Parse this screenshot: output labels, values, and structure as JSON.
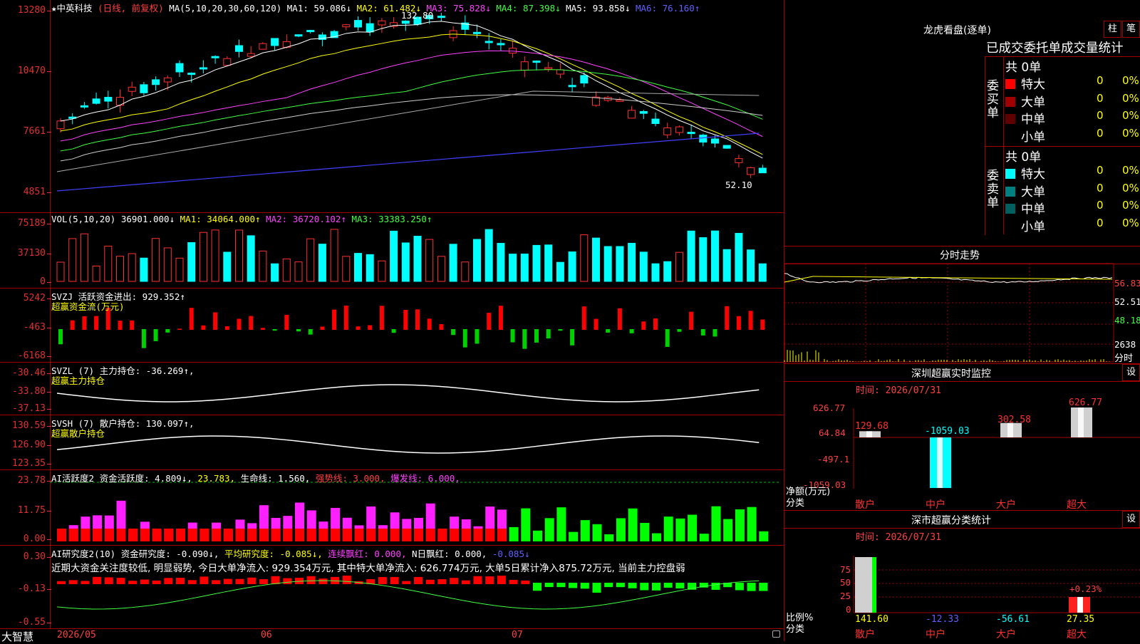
{
  "stock_header": {
    "title": "★中英科技",
    "mode": "(日线, 前复权)",
    "ma_label": "MA(5,10,20,30,60,120)",
    "ma1": "MA1: 59.086↓",
    "ma2": "MA2: 61.482↓",
    "ma3": "MA3: 75.828↓",
    "ma4": "MA4: 87.398↓",
    "ma5": "MA5: 93.858↓",
    "ma6": "MA6: 76.160↑",
    "high_mark": "132.80",
    "low_mark": "52.10"
  },
  "price_axis": [
    "13280",
    "10470",
    "7661",
    "4851"
  ],
  "vol": {
    "label": "VOL(5,10,20)",
    "val": "36901.000↓",
    "ma1": "MA1: 34064.000↑",
    "ma2": "MA2: 36720.102↑",
    "ma3": "MA3: 33383.250↑",
    "axis": [
      "75189",
      "37130",
      "0"
    ]
  },
  "svzj": {
    "label": "SVZJ  活跃资金进出: 929.352↑",
    "sub": "超赢资金流(万元)",
    "axis": [
      "5242",
      "-463",
      "-6168"
    ]
  },
  "svzl": {
    "label": "SVZL (7) 主力持仓: -36.269↑,",
    "sub": "超赢主力持仓",
    "axis": [
      "-30.46",
      "-33.80",
      "-37.13"
    ]
  },
  "svsh": {
    "label": "SVSH (7) 散户持仓: 130.097↑,",
    "sub": "超赢散户持仓",
    "axis": [
      "130.59",
      "126.90",
      "123.35"
    ]
  },
  "ai_act": {
    "a": "AI活跃度2 资金活跃度: 4.809↓,",
    "b": "23.783,",
    "c": "生命线: 1.560,",
    "d": "强势线: 3.000,",
    "e": "爆发线: 6.000,",
    "axis": [
      "23.78",
      "11.75",
      "0.00"
    ]
  },
  "ai_res": {
    "a": "AI研究度2(10) 资金研究度: -0.090↓,",
    "b": "平均研究度: -0.085↓,",
    "c": "连续飘红: 0.000,",
    "d": "N日飘红: 0.000,",
    "e": "-0.085↓",
    "desc": "近期大资金关注度较低, 明显弱势, 今日大单净流入: 929.354万元, 其中特大单净流入: 626.774万元, 大单5日累计净入875.72万元, 当前主力控盘弱",
    "axis": [
      "0.30",
      "-0.13",
      "-0.55"
    ]
  },
  "bottom": {
    "brand": "大智慧",
    "dates": [
      "2026/05",
      "06",
      "07"
    ]
  },
  "dragon": {
    "title": "龙虎看盘(逐单)",
    "btn1": "柱",
    "btn2": "笔",
    "subtitle": "已成交委托单成交量统计",
    "buy_label": "委买单",
    "sell_label": "委卖单",
    "buy_total": "共 0单",
    "sell_total": "共 0单",
    "buy_rows": [
      {
        "name": "特大",
        "count": "0",
        "pct": "0%",
        "color": "#ff0000"
      },
      {
        "name": "大单",
        "count": "0",
        "pct": "0%",
        "color": "#a00000"
      },
      {
        "name": "中单",
        "count": "0",
        "pct": "0%",
        "color": "#600000"
      },
      {
        "name": "小单",
        "count": "0",
        "pct": "0%",
        "color": "#000000"
      }
    ],
    "sell_rows": [
      {
        "name": "特大",
        "count": "0",
        "pct": "0%",
        "color": "#00ffff"
      },
      {
        "name": "大单",
        "count": "0",
        "pct": "0%",
        "color": "#008080"
      },
      {
        "name": "中单",
        "count": "0",
        "pct": "0%",
        "color": "#006060"
      },
      {
        "name": "小单",
        "count": "0",
        "pct": "0%",
        "color": "#000000"
      }
    ]
  },
  "intraday": {
    "title": "分时走势",
    "axis": [
      "56.83",
      "52.51",
      "48.18"
    ],
    "vol_axis": [
      "2638",
      "分时"
    ]
  },
  "sz_monitor": {
    "title": "深圳超赢实时监控",
    "btn": "设",
    "time": "时间: 2026/07/31",
    "axis": [
      "626.77",
      "64.84",
      "-497.1",
      "-1059.03"
    ],
    "y_title": "净额(万元)",
    "x_title": "分类",
    "categories": [
      "散户",
      "中户",
      "大户",
      "超大"
    ],
    "values": [
      "129.68",
      "-1059.03",
      "302.58",
      "626.77"
    ]
  },
  "sz_class": {
    "title": "深市超赢分类统计",
    "btn": "设",
    "time": "时间: 2026/07/31",
    "axis": [
      "75",
      "50",
      "25",
      "0"
    ],
    "y_title": "比例%",
    "x_title": "分类",
    "categories": [
      "散户",
      "中户",
      "大户",
      "超大"
    ],
    "values": [
      "141.60",
      "-12.33",
      "-56.61",
      "27.35"
    ],
    "note": "+0.23%"
  },
  "chart_data": [
    {
      "type": "bar",
      "title": "深圳超赢实时监控",
      "ylabel": "净额(万元)",
      "xlabel": "分类",
      "categories": [
        "散户",
        "中户",
        "大户",
        "超大"
      ],
      "values": [
        129.68,
        -1059.03,
        302.58,
        626.77
      ],
      "ylim": [
        -1059.03,
        626.77
      ]
    },
    {
      "type": "bar",
      "title": "深市超赢分类统计",
      "ylabel": "比例%",
      "xlabel": "分类",
      "categories": [
        "散户",
        "中户",
        "大户",
        "超大"
      ],
      "values": [
        141.6,
        -12.33,
        -56.61,
        27.35
      ],
      "ylim": [
        0,
        75
      ]
    }
  ]
}
